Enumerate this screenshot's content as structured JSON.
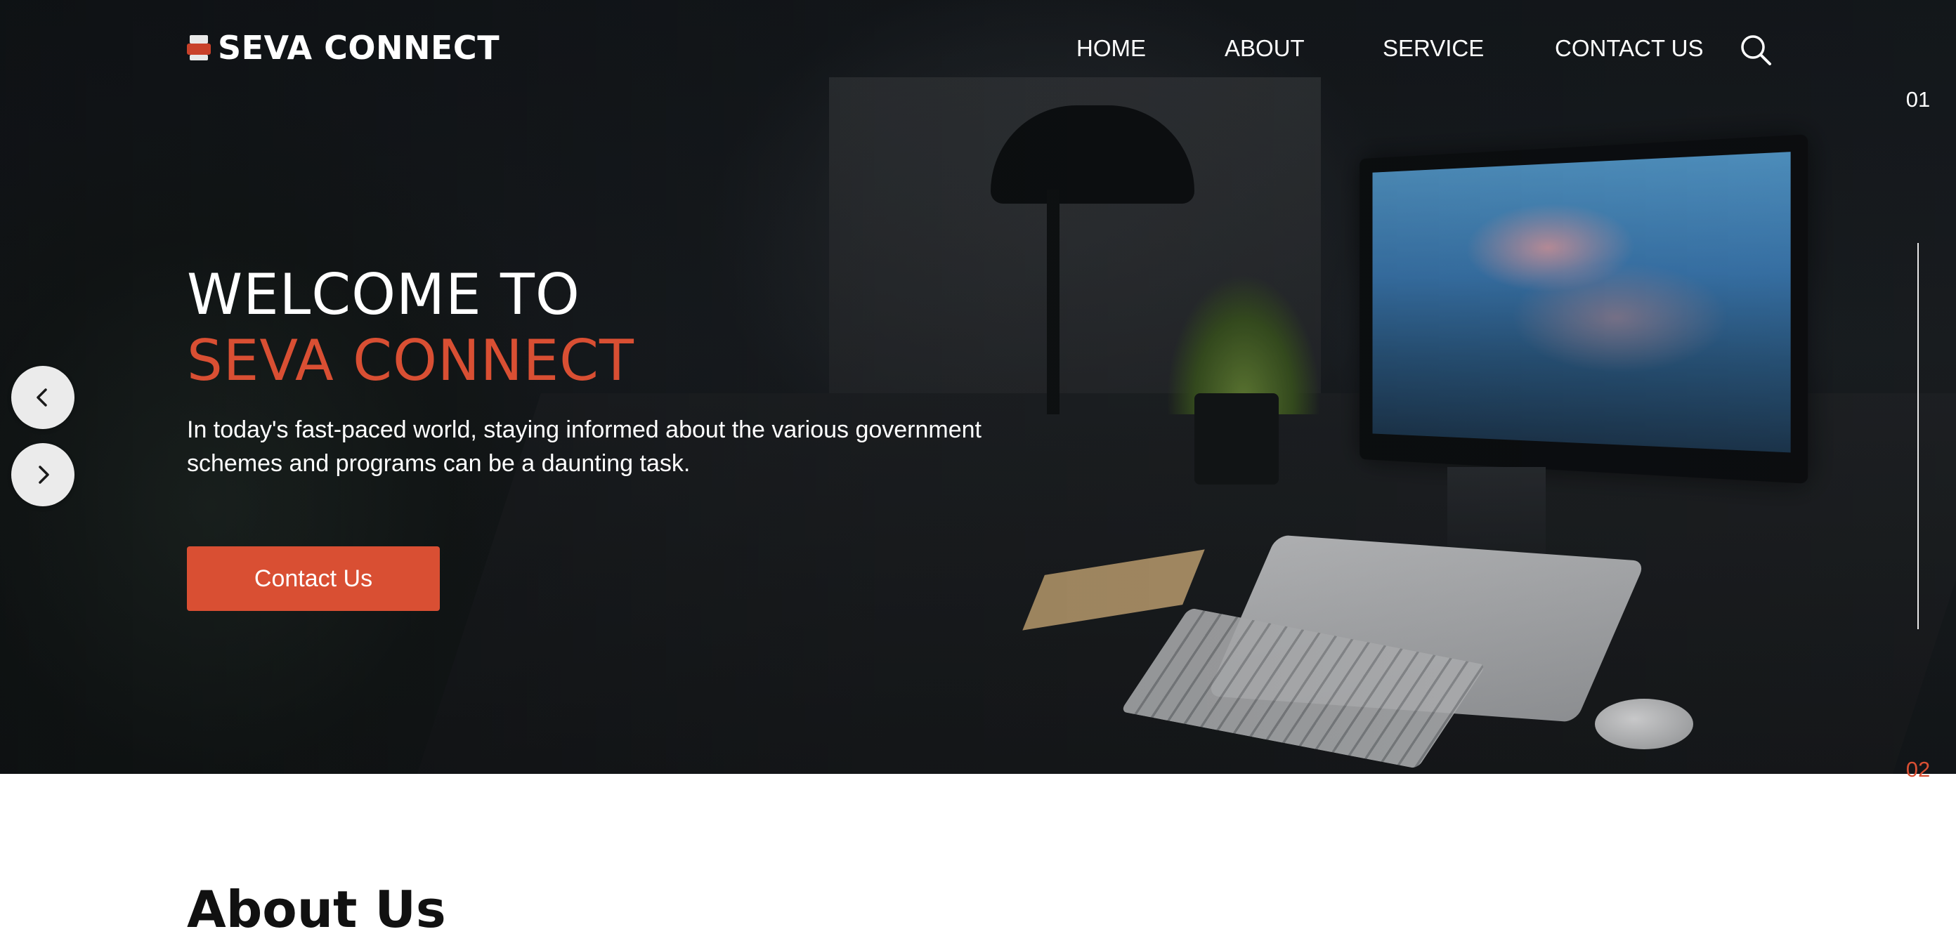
{
  "header": {
    "logo_text": "SEVA CONNECT",
    "logo_icon": "printer-icon",
    "nav": [
      {
        "label": "HOME"
      },
      {
        "label": "ABOUT"
      },
      {
        "label": "SERVICE"
      },
      {
        "label": "CONTACT US"
      }
    ],
    "search_icon": "search-icon"
  },
  "hero": {
    "title_line1": "WELCOME TO",
    "title_line2": "SEVA CONNECT",
    "description": "In today's fast-paced world, staying informed about the various government schemes and programs can be a daunting task.",
    "cta_label": "Contact Us",
    "slide_current": "01",
    "slide_next": "02",
    "prev_icon": "chevron-left-icon",
    "next_icon": "chevron-right-icon"
  },
  "about": {
    "title": "About Us"
  },
  "colors": {
    "accent": "#d94f33",
    "hero_text": "#ffffff",
    "arrow_bg": "#ebebeb"
  }
}
